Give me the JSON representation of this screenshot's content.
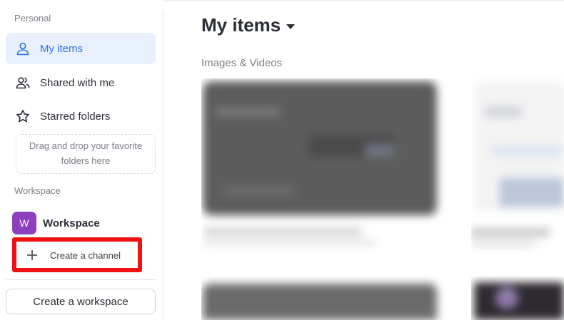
{
  "sidebar": {
    "personal_label": "Personal",
    "items": [
      {
        "label": "My items",
        "icon": "person-icon",
        "active": true
      },
      {
        "label": "Shared with me",
        "icon": "people-icon",
        "active": false
      },
      {
        "label": "Starred folders",
        "icon": "star-icon",
        "active": false
      }
    ],
    "dropzone_text": "Drag and drop your favorite folders here",
    "workspace_label": "Workspace",
    "workspace": {
      "avatar_letter": "W",
      "name": "Workspace",
      "avatar_color": "#8e3fbd"
    },
    "create_channel_label": "Create a channel",
    "create_workspace_label": "Create a workspace"
  },
  "main": {
    "title": "My items",
    "section_label": "Images & Videos"
  },
  "colors": {
    "accent": "#2f74e6",
    "active_bg": "#e8f0fd",
    "highlight": "#f01212"
  }
}
